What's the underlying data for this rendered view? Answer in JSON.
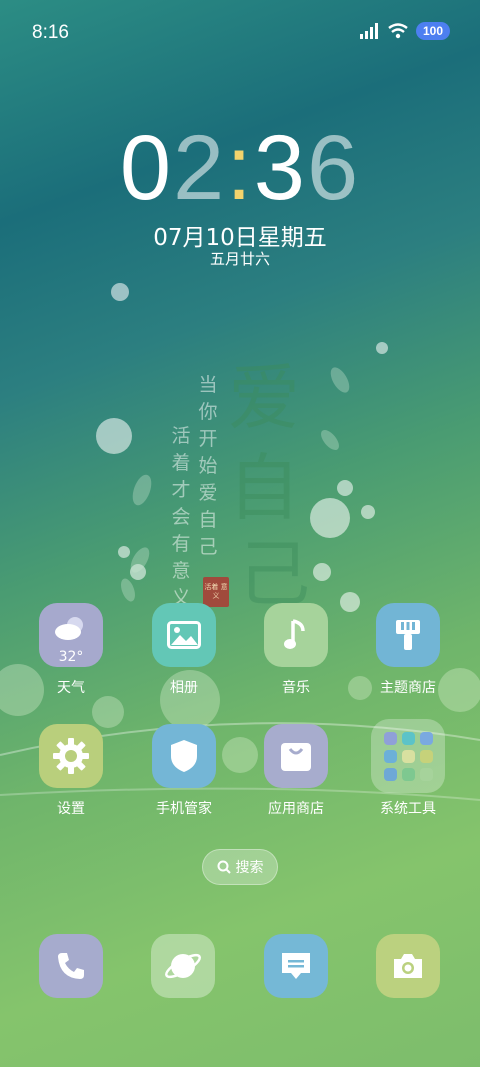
{
  "status_bar": {
    "time": "8:16",
    "battery": "100"
  },
  "lockclock": {
    "digits": [
      "0",
      "2",
      ":",
      "3",
      "6"
    ],
    "date": "07月10日星期五",
    "lunar": "五月廿六"
  },
  "wallpaper": {
    "poem_col1": "当你开始爱自己",
    "poem_col2": "活着才会有意义",
    "calligraphy": [
      "爱",
      "自",
      "己"
    ],
    "seal": "活着\n意义"
  },
  "apps_row1": [
    {
      "label": "天气",
      "temp": "32°",
      "icon": "weather-icon",
      "color": "#a6a9cd"
    },
    {
      "label": "相册",
      "icon": "gallery-icon",
      "color": "#63c7b6"
    },
    {
      "label": "音乐",
      "icon": "music-icon",
      "color": "#a6d39b"
    },
    {
      "label": "主题商店",
      "icon": "theme-brush-icon",
      "color": "#72b5d5"
    }
  ],
  "apps_row2": [
    {
      "label": "设置",
      "icon": "gear-icon",
      "color": "#b9cf7c"
    },
    {
      "label": "手机管家",
      "icon": "shield-icon",
      "color": "#74b6d6"
    },
    {
      "label": "应用商店",
      "icon": "shopping-bag-icon",
      "color": "#a7accd"
    },
    {
      "label": "系统工具",
      "icon": "folder-icon",
      "color": "rgba(255,255,255,0.28)"
    }
  ],
  "search": {
    "label": "搜索"
  },
  "dock": [
    {
      "name": "phone",
      "icon": "phone-icon",
      "color": "#a6abcd"
    },
    {
      "name": "browser",
      "icon": "browser-planet-icon",
      "color": "rgba(255,255,255,0.35)"
    },
    {
      "name": "messages",
      "icon": "message-icon",
      "color": "#75b8d6"
    },
    {
      "name": "camera",
      "icon": "camera-icon",
      "color": "#bbd17f"
    }
  ]
}
